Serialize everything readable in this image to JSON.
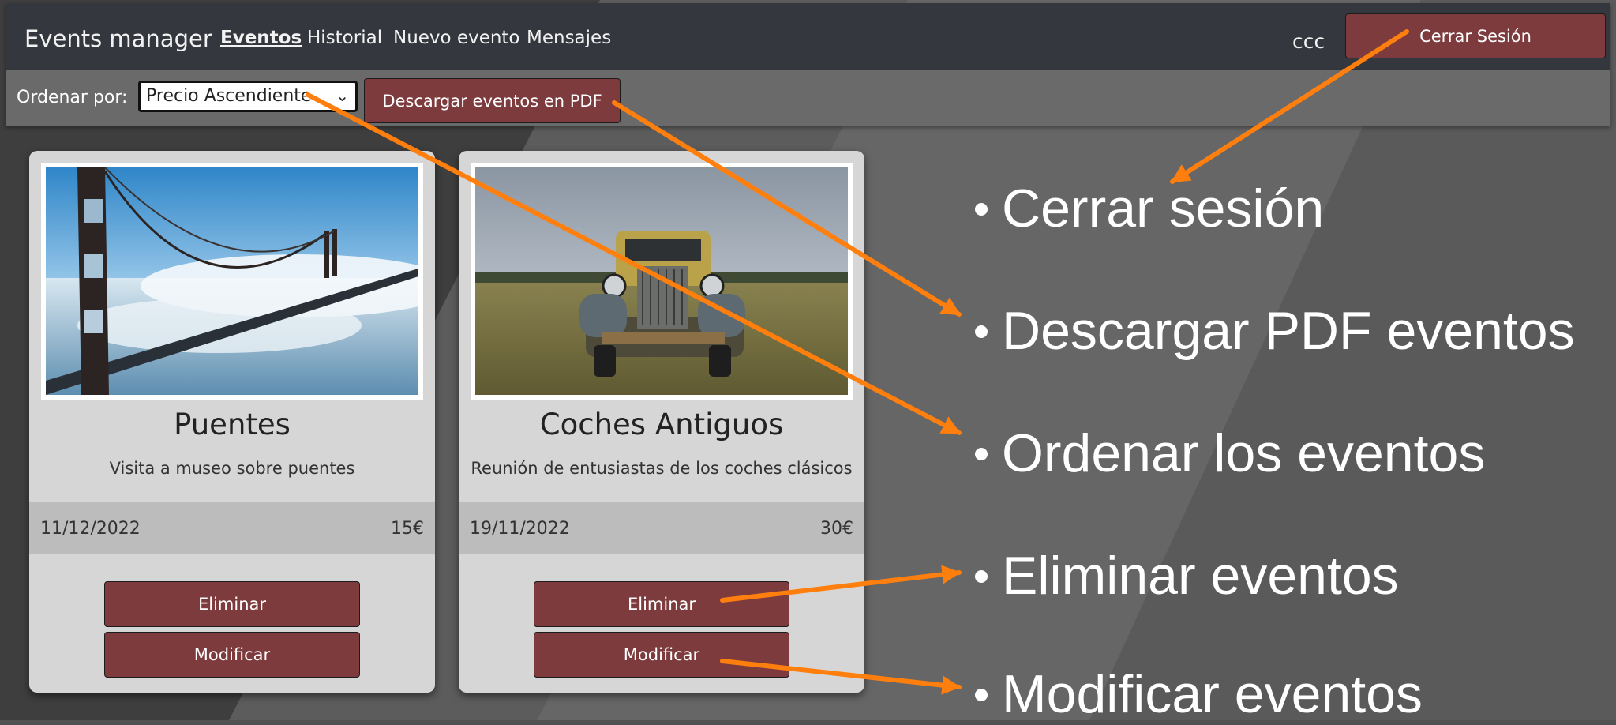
{
  "navbar": {
    "brand": "Events manager",
    "links": [
      {
        "label": "Eventos",
        "active": true
      },
      {
        "label": "Historial",
        "active": false
      },
      {
        "label": "Nuevo evento",
        "active": false
      },
      {
        "label": "Mensajes",
        "active": false
      }
    ],
    "username": "ccc",
    "logout_label": "Cerrar Sesión"
  },
  "toolbar": {
    "sort_label": "Ordenar por:",
    "sort_selected": "Precio Ascendiente",
    "pdf_label": "Descargar eventos en PDF"
  },
  "events": [
    {
      "title": "Puentes",
      "description": "Visita a museo sobre puentes",
      "date": "11/12/2022",
      "price": "15€",
      "delete_label": "Eliminar",
      "edit_label": "Modificar"
    },
    {
      "title": "Coches Antiguos",
      "description": "Reunión de entusiastas de los coches clásicos",
      "date": "19/11/2022",
      "price": "30€",
      "delete_label": "Eliminar",
      "edit_label": "Modificar"
    }
  ],
  "annotations": [
    "Cerrar sesión",
    "Descargar PDF eventos",
    "Ordenar los eventos",
    "Eliminar eventos",
    "Modificar eventos"
  ],
  "colors": {
    "button": "#7d3b3d",
    "navbar": "#34373d",
    "toolbar": "#6a6a6a",
    "card": "#d6d6d6",
    "arrow": "#ff7f0e"
  },
  "icons": {
    "select_indicator": "chevron-down-icon",
    "bullet": "bullet-dot-icon"
  }
}
